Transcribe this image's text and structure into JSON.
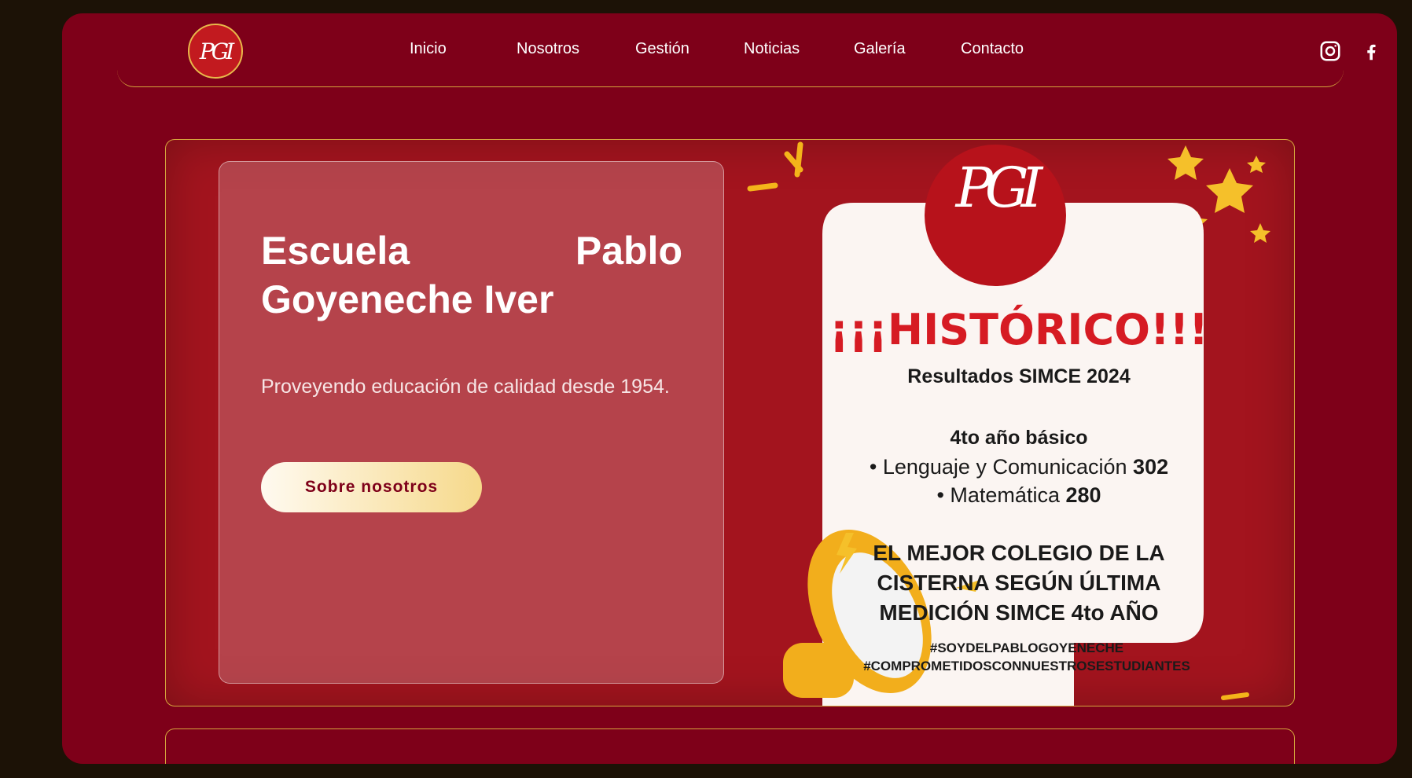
{
  "logo": {
    "text": "PGI"
  },
  "nav": {
    "items": [
      "Inicio",
      "Nosotros",
      "Gestión",
      "Noticias",
      "Galería",
      "Contacto"
    ]
  },
  "socials": {
    "icons": [
      "instagram-icon",
      "facebook-icon"
    ]
  },
  "hero": {
    "title": "Escuela Pablo Goyeneche Iver",
    "subtitle": "Proveyendo educación de calidad desde 1954.",
    "button": "Sobre nosotros"
  },
  "poster": {
    "headline": "¡¡¡HISTÓRICO!!!",
    "results_title": "Resultados SIMCE 2024",
    "level": "4to año básico",
    "line1_label": "• Lenguaje y Comunicación",
    "line1_value": "302",
    "line2_label": "• Matemática",
    "line2_value": "280",
    "claim1": "EL MEJOR COLEGIO DE LA",
    "claim2": "CISTERNA SEGÚN ÚLTIMA",
    "claim3": "MEDICIÓN SIMCE 4to AÑO",
    "tag1": "#SOYDELPABLOGOYENECHE",
    "tag2": "#COMPROMETIDOSCONNUESTROSESTUDIANTES",
    "logo_text": "PGI"
  },
  "colors": {
    "brand": "#7e0019",
    "accent": "#d4a53c",
    "hero_bg": "#a3141e"
  }
}
